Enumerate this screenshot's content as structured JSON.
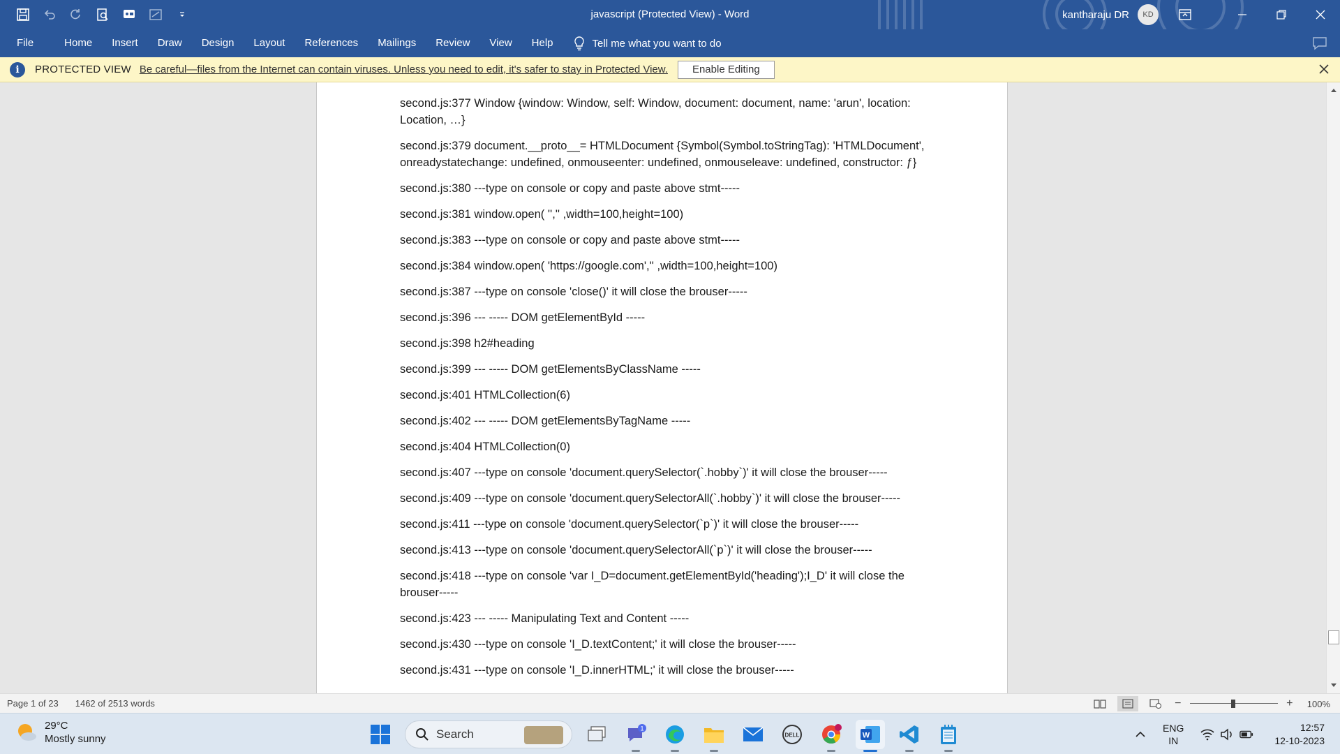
{
  "window": {
    "title": "javascript (Protected View)  -  Word",
    "user_name": "kantharaju DR",
    "user_initials": "KD"
  },
  "quick_access": {
    "icons": [
      "save-icon",
      "undo-icon",
      "redo-icon",
      "print-preview-icon",
      "touch-mode-icon",
      "form-icon",
      "customize-qat-icon"
    ]
  },
  "ribbon": {
    "tabs": [
      "File",
      "Home",
      "Insert",
      "Draw",
      "Design",
      "Layout",
      "References",
      "Mailings",
      "Review",
      "View",
      "Help"
    ],
    "tell_me": "Tell me what you want to do"
  },
  "protected_view": {
    "label": "PROTECTED VIEW",
    "message": "Be careful—files from the Internet can contain viruses. Unless you need to edit, it's safer to stay in Protected View.",
    "enable_button": "Enable Editing"
  },
  "document": {
    "paragraphs": [
      "second.js:377 Window {window: Window, self: Window, document: document, name: 'arun', location: Location, …}",
      "second.js:379 document.__proto__= HTMLDocument {Symbol(Symbol.toStringTag): 'HTMLDocument', onreadystatechange: undefined, onmouseenter: undefined, onmouseleave: undefined, constructor: ƒ}",
      "second.js:380 ---type on console or copy and paste above stmt-----",
      "second.js:381 window.open( '','' ,width=100,height=100)",
      "second.js:383 ---type on console or copy and paste above stmt-----",
      "second.js:384 window.open( 'https://google.com','' ,width=100,height=100)",
      "second.js:387 ---type on console 'close()' it will close the brouser-----",
      "second.js:396 --- ----- DOM  getElementById -----",
      "second.js:398 h2#heading",
      "second.js:399 --- ----- DOM  getElementsByClassName -----",
      "second.js:401 HTMLCollection(6)",
      "second.js:402 --- ----- DOM  getElementsByTagName -----",
      "second.js:404 HTMLCollection(0)",
      "second.js:407 ---type on console 'document.querySelector(`.hobby`)' it will close the brouser-----",
      "second.js:409 ---type on console 'document.querySelectorAll(`.hobby`)' it will close the brouser-----",
      "second.js:411 ---type on console 'document.querySelector(`p`)' it will close the brouser-----",
      "second.js:413 ---type on console 'document.querySelectorAll(`p`)' it will close the brouser-----",
      "second.js:418 ---type on console 'var I_D=document.getElementById('heading');I_D' it will close the brouser-----",
      "second.js:423 --- ----- Manipulating Text and Content -----",
      "second.js:430 ---type on console 'I_D.textContent;' it will close the brouser-----",
      "second.js:431 ---type on console 'I_D.innerHTML;' it will close the brouser-----"
    ]
  },
  "status": {
    "page": "Page 1 of 23",
    "words": "1462 of 2513 words",
    "zoom": "100%",
    "zoom_minus": "−",
    "zoom_plus": "+"
  },
  "taskbar": {
    "weather_temp": "29°C",
    "weather_desc": "Mostly sunny",
    "search_placeholder": "Search",
    "teams_badge": "1",
    "lang_top": "ENG",
    "lang_bottom": "IN",
    "time": "12:57",
    "date": "12-10-2023"
  },
  "colors": {
    "word_blue": "#2b579a",
    "protected_view_bg": "#fdf6c7",
    "taskbar_bg": "#dce6f1"
  }
}
